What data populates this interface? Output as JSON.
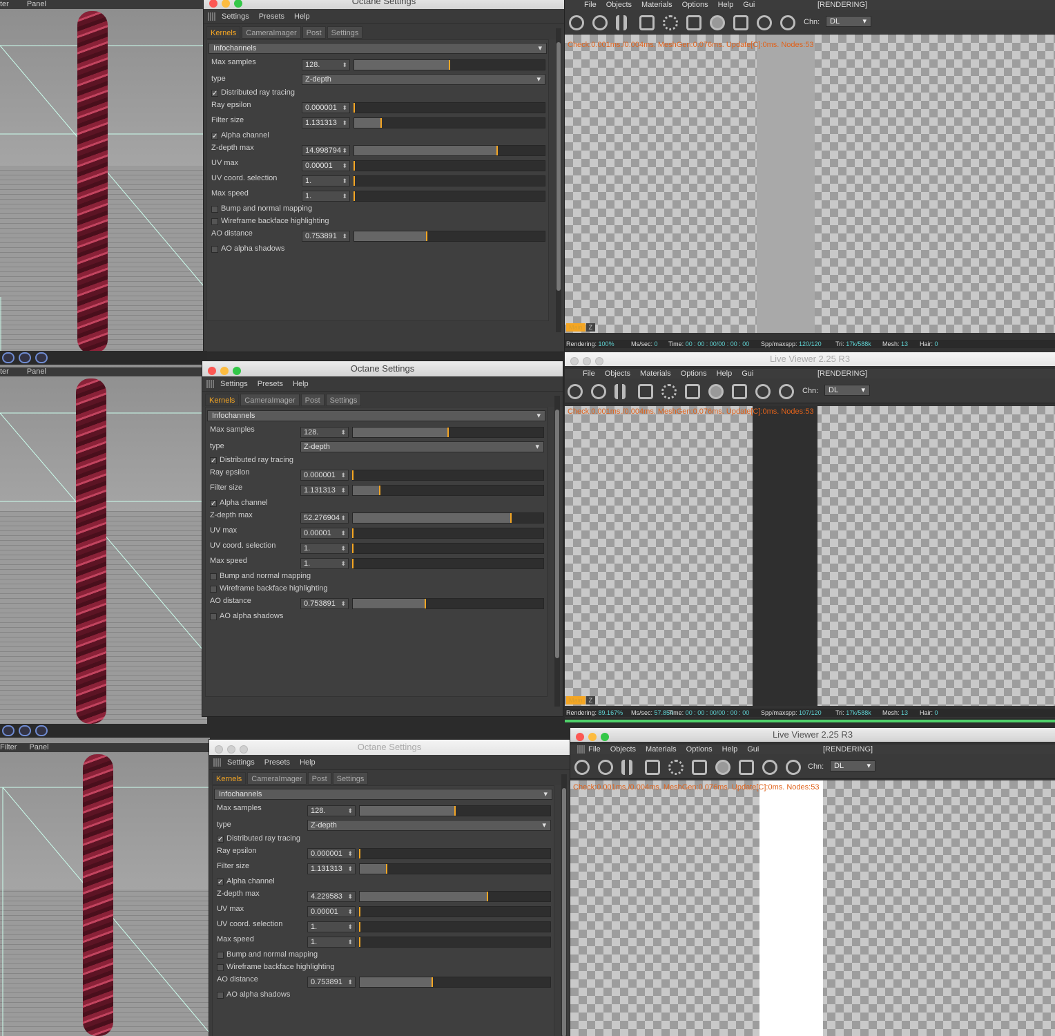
{
  "viewport": {
    "menu": [
      "ter",
      "Panel"
    ],
    "menu3": [
      "Filter",
      "Panel"
    ]
  },
  "octane": {
    "title": "Octane Settings",
    "menu": [
      "Settings",
      "Presets",
      "Help"
    ],
    "tabs": [
      "Kernels",
      "CameraImager",
      "Post",
      "Settings"
    ],
    "kernel": "Infochannels",
    "labels": {
      "max_samples": "Max samples",
      "type": "type",
      "distributed": "Distributed ray tracing",
      "ray_epsilon": "Ray epsilon",
      "filter_size": "Filter size",
      "alpha_channel": "Alpha channel",
      "zdepth_max": "Z-depth max",
      "uv_max": "UV max",
      "uv_coord": "UV coord. selection",
      "max_speed": "Max speed",
      "bump": "Bump and normal mapping",
      "wireframe": "Wireframe backface highlighting",
      "ao_distance": "AO distance",
      "ao_alpha": "AO alpha shadows"
    },
    "check": "✓",
    "values": {
      "max_samples": "128.",
      "type": "Z-depth",
      "ray_epsilon": "0.000001",
      "filter_size": "1.131313",
      "uv_max": "0.00001",
      "uv_coord": "1.",
      "max_speed": "1.",
      "ao_distance": "0.753891"
    },
    "panels": [
      {
        "zdepth_max": "14.998794",
        "zdepth_slider": 0.75
      },
      {
        "zdepth_max": "52.276904",
        "zdepth_slider": 0.83
      },
      {
        "zdepth_max": "4.229583",
        "zdepth_slider": 0.67
      }
    ],
    "sliders": {
      "max_samples": 0.5,
      "ray_epsilon": 0.0,
      "filter_size": 0.14,
      "uv_max": 0.0,
      "uv_coord": 0.0,
      "max_speed": 0.0,
      "ao_distance": 0.38
    }
  },
  "liveviewer": {
    "title": "Live Viewer 2.25 R3",
    "menu": [
      "File",
      "Objects",
      "Materials",
      "Options",
      "Help",
      "Gui"
    ],
    "state": "[RENDERING]",
    "chn_label": "Chn:",
    "chn_value": "DL",
    "info": "Check:0.001ms./0.004ms. MeshGen:0.076ms. Update[C]:0ms. Nodes:53",
    "chtabs": [
      "Main",
      "Z"
    ],
    "status1": {
      "rendering": "100%",
      "ms": "0",
      "time": "00 : 00 : 00/00 : 00 : 00",
      "spp": "120/120",
      "tri": "17k/588k",
      "mesh": "13",
      "hair": "0"
    },
    "status2": {
      "rendering": "89.167%",
      "ms": "57.854",
      "time": "00 : 00 : 00/00 : 00 : 00",
      "spp": "107/120",
      "tri": "17k/588k",
      "mesh": "13",
      "hair": "0"
    },
    "status_labels": {
      "rendering": "Rendering:",
      "ms": "Ms/sec:",
      "time": "Time:",
      "spp": "Spp/maxspp:",
      "tri": "Tri:",
      "mesh": "Mesh:",
      "hair": "Hair:"
    },
    "hair_colors": [
      "#a9a9a9",
      "#2f2f2f",
      "#ffffff"
    ]
  },
  "colors": {
    "accent": "#f5a623",
    "info": "#e0621b",
    "status_value": "#5fd1d1",
    "progress": "#4fd06a"
  }
}
